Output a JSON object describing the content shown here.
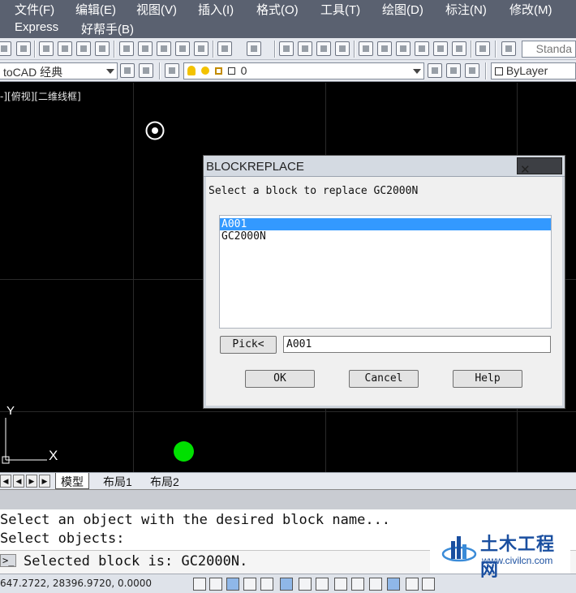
{
  "menubar": {
    "row1": [
      "文件(F)",
      "编辑(E)",
      "视图(V)",
      "插入(I)",
      "格式(O)",
      "工具(T)",
      "绘图(D)",
      "标注(N)",
      "修改(M)"
    ],
    "row2": [
      "Express",
      "好帮手(B)"
    ]
  },
  "toolbar": {
    "text_style_combo": "Standa",
    "workspace_combo": "toCAD 经典",
    "layer_combo": "0",
    "color_combo": "ByLayer"
  },
  "viewport": {
    "label": "-][俯视][二维线框]",
    "ucs_x": "X",
    "ucs_y": "Y"
  },
  "dialog": {
    "title": "BLOCKREPLACE",
    "close_glyph": "✕",
    "message": "Select a block to replace GC2000N",
    "list_items": [
      "A001",
      "GC2000N"
    ],
    "selected_index": 0,
    "pick_button": "Pick<",
    "name_value": "A001",
    "ok_button": "OK",
    "cancel_button": "Cancel",
    "help_button": "Help"
  },
  "tabs": {
    "model": "模型",
    "layout1": "布局1",
    "layout2": "布局2"
  },
  "command": {
    "line1": "Select an object with the desired block name...",
    "line2": "Select objects:",
    "prompt": ">_",
    "line3": "Selected block is: GC2000N."
  },
  "status": {
    "coords": "647.2722, 28396.9720, 0.0000"
  },
  "watermark": {
    "name": "土木工程网",
    "url": "www.civilcn.com"
  },
  "colors": {
    "menu_bg": "#5a6170",
    "selection": "#3399ff",
    "green_marker": "#00e000"
  }
}
